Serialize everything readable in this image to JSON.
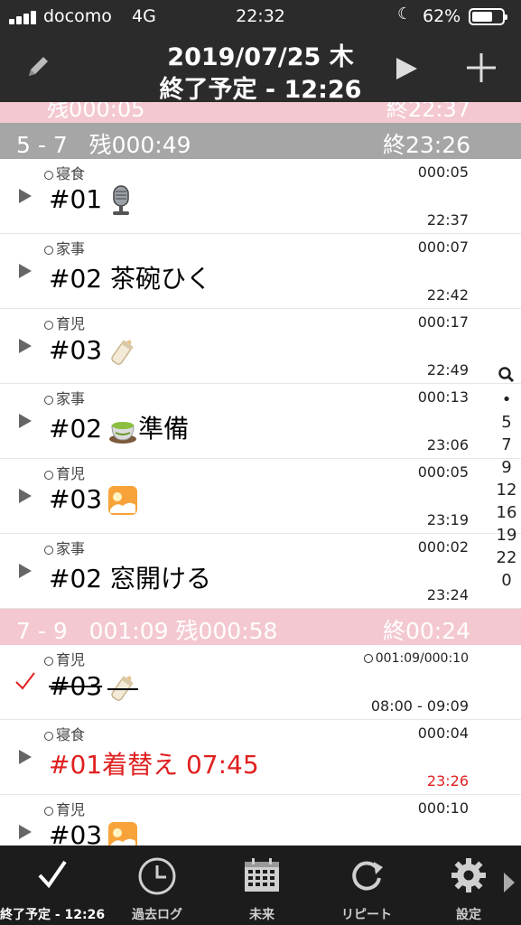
{
  "status_bar": {
    "carrier": "docomo",
    "network": "4G",
    "time": "22:32",
    "battery": "62%",
    "battery_level": 0.62
  },
  "header": {
    "date": "2019/07/25 木",
    "subtitle": "終了予定 - 12:26",
    "icons": [
      "pencil-icon",
      "play-icon",
      "plus-icon"
    ]
  },
  "peek_section": {
    "left": "残000:05",
    "right": "終22:37"
  },
  "sections": [
    {
      "left": "5 - 7   残000:49",
      "right": "終23:26",
      "color": "#a6a6a6"
    },
    {
      "left": "7 - 9   001:09 残000:58",
      "right": "終00:24",
      "color": "#f4c8d0"
    }
  ],
  "tasks_a": [
    {
      "category": "寝食",
      "duration": "000:05",
      "title": "#01",
      "emoji": "microphone",
      "time": "22:37"
    },
    {
      "category": "家事",
      "duration": "000:07",
      "title": "#02 茶碗ひく",
      "time": "22:42"
    },
    {
      "category": "育児",
      "duration": "000:17",
      "title": "#03",
      "emoji": "baby-bottle",
      "time": "22:49"
    },
    {
      "category": "家事",
      "duration": "000:13",
      "title": "#02",
      "title_suffix": "準備",
      "emoji": "green-tea",
      "time": "23:06"
    },
    {
      "category": "育児",
      "duration": "000:05",
      "title": "#03",
      "emoji": "sunrise",
      "time": "23:19"
    },
    {
      "category": "家事",
      "duration": "000:02",
      "title": "#02 窓開ける",
      "time": "23:24"
    }
  ],
  "tasks_b": [
    {
      "category": "育児",
      "duration": "001:09/000:10",
      "title": "#03",
      "emoji": "baby-bottle",
      "time": "08:00 - 09:09",
      "done": true
    },
    {
      "category": "寝食",
      "duration": "000:04",
      "title": "#01着替え 07:45",
      "time": "23:26",
      "highlight": true
    },
    {
      "category": "育児",
      "duration": "000:10",
      "title": "#03",
      "emoji": "sunrise"
    }
  ],
  "index_bar": [
    "•",
    "5",
    "7",
    "9",
    "12",
    "16",
    "19",
    "22",
    "0"
  ],
  "tabs": [
    {
      "label": "終了予定 - 12:26",
      "icon": "check-icon",
      "active": true
    },
    {
      "label": "過去ログ",
      "icon": "clock-icon"
    },
    {
      "label": "未来",
      "icon": "calendar-icon"
    },
    {
      "label": "リピート",
      "icon": "repeat-icon"
    },
    {
      "label": "設定",
      "icon": "gear-icon"
    }
  ],
  "colors": {
    "header_bg": "#2b2b2b",
    "section_gray": "#a6a6a6",
    "section_pink": "#f4c8d0",
    "accent_red": "#e02020",
    "tabbar_bg": "#1c1c1c"
  }
}
